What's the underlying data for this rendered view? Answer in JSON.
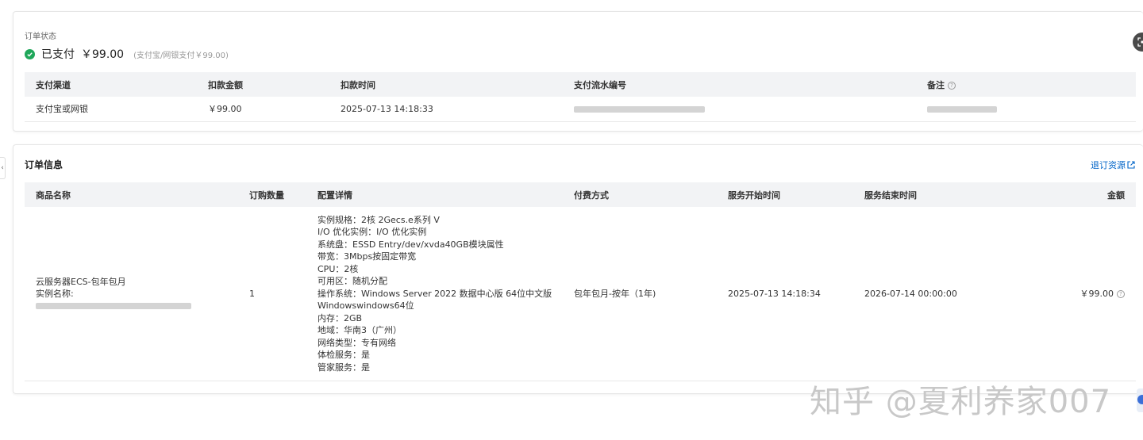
{
  "status_card": {
    "label": "订单状态",
    "status": "已支付",
    "amount": "￥99.00",
    "sub_text": "(支付宝/网银支付￥99.00)",
    "columns": [
      "支付渠道",
      "扣款金额",
      "扣款时间",
      "支付流水编号",
      "备注"
    ],
    "row": {
      "channel": "支付宝或网银",
      "amount": "￥99.00",
      "time": "2025-07-13 14:18:33"
    }
  },
  "order_card": {
    "title": "订单信息",
    "refund_link": "退订资源",
    "columns": [
      "商品名称",
      "订购数量",
      "配置详情",
      "付费方式",
      "服务开始时间",
      "服务结束时间",
      "金额"
    ],
    "row": {
      "product_name": "云服务器ECS-包年包月",
      "instance_label": "实例名称:",
      "quantity": "1",
      "config": [
        "实例规格：2核 2Gecs.e系列 V",
        "I/O 优化实例：I/O 优化实例",
        "系统盘：ESSD Entry/dev/xvda40GB模块属性",
        "带宽：3Mbps按固定带宽",
        "CPU：2核",
        "可用区：随机分配",
        "操作系统：Windows Server 2022 数据中心版 64位中文版",
        "Windowswindows64位",
        "内存：2GB",
        "地域：华南3（广州）",
        "网络类型：专有网络",
        "体检服务：是",
        "管家服务：是"
      ],
      "billing": "包年包月-按年（1年)",
      "start": "2025-07-13 14:18:34",
      "end": "2026-07-14 00:00:00",
      "amount": "￥99.00"
    }
  },
  "watermark": "知乎 @夏利养家007",
  "colors": {
    "success": "#1fa75a",
    "link": "#0064c8",
    "header_bg": "#f2f3f5"
  }
}
